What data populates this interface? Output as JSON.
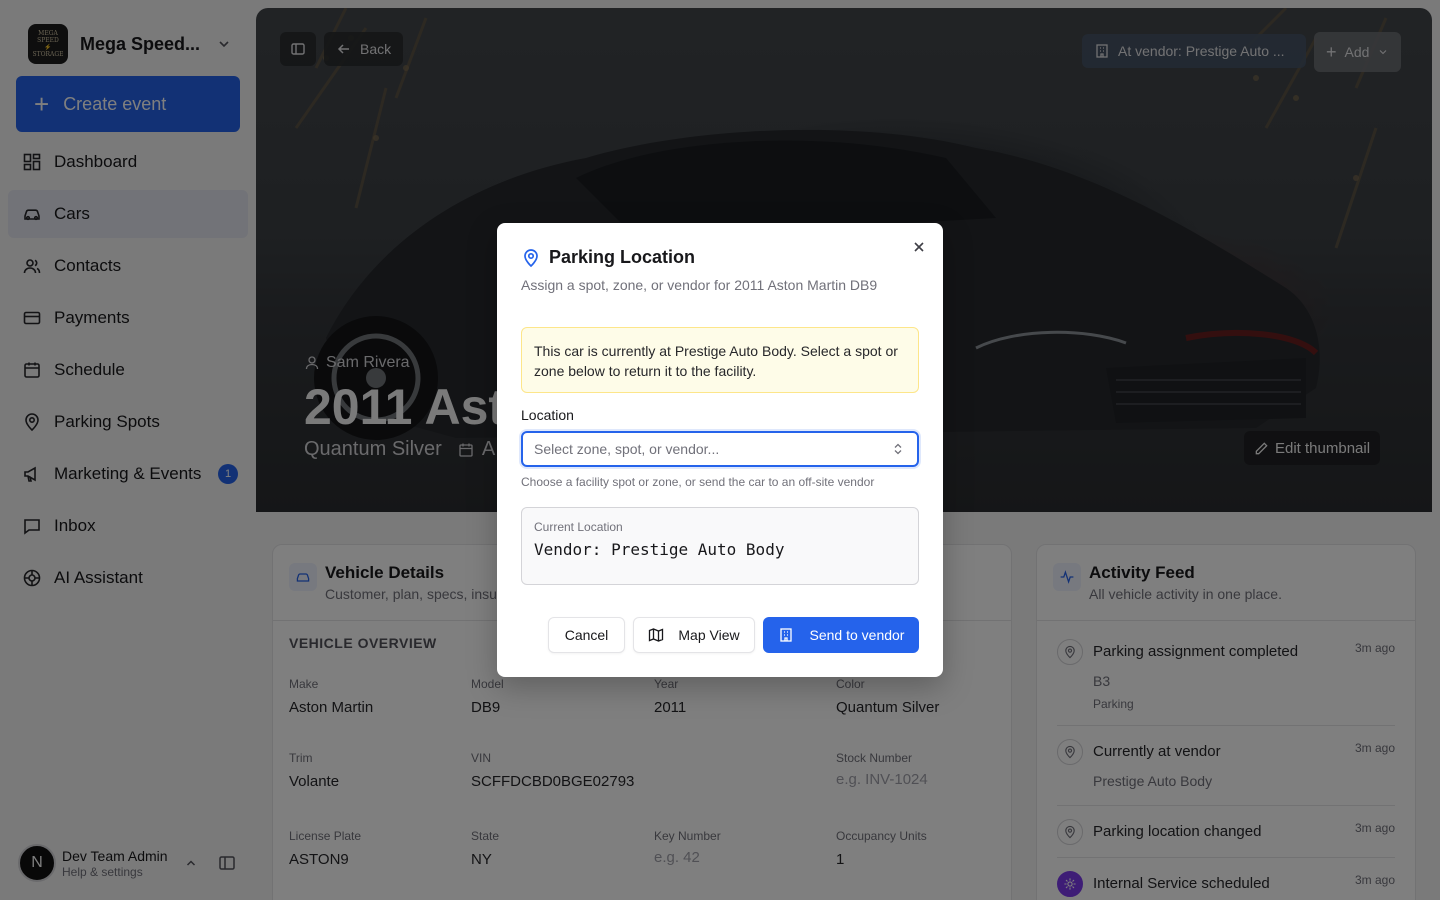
{
  "sidebar": {
    "brand_name": "Mega Speed...",
    "logo_text": [
      "MEGA SPEED",
      "STORAGE"
    ],
    "create_label": "Create event",
    "items": [
      {
        "label": "Dashboard",
        "icon": "dashboard-icon"
      },
      {
        "label": "Cars",
        "icon": "car-icon",
        "active": true
      },
      {
        "label": "Contacts",
        "icon": "contacts-icon"
      },
      {
        "label": "Payments",
        "icon": "credit-card-icon"
      },
      {
        "label": "Schedule",
        "icon": "calendar-icon"
      },
      {
        "label": "Parking Spots",
        "icon": "map-pin-icon"
      },
      {
        "label": "Marketing & Events",
        "icon": "megaphone-icon",
        "badge": "1"
      },
      {
        "label": "Inbox",
        "icon": "message-icon"
      },
      {
        "label": "AI Assistant",
        "icon": "brain-icon"
      }
    ],
    "user": {
      "initial": "N",
      "name": "Dev Team Admin",
      "sub": "Help & settings"
    }
  },
  "hero": {
    "back_label": "Back",
    "vendor_label": "At vendor: Prestige Auto ...",
    "add_label": "Add",
    "owner": "Sam Rivera",
    "title": "2011 Ast",
    "color": "Quantum Silver",
    "sub_extra": "A",
    "edit_thumbnail": "Edit thumbnail"
  },
  "vehicle_details": {
    "title": "Vehicle Details",
    "desc": "Customer, plan, specs, insu",
    "section": "VEHICLE OVERVIEW",
    "fields": [
      {
        "label": "Make",
        "value": "Aston Martin"
      },
      {
        "label": "Model",
        "value": "DB9"
      },
      {
        "label": "Year",
        "value": "2011"
      },
      {
        "label": "Color",
        "value": "Quantum Silver"
      },
      {
        "label": "Trim",
        "value": "Volante"
      },
      {
        "label": "VIN",
        "value": "SCFFDCBD0BGE02793"
      },
      {
        "label": "Stock Number",
        "value": "e.g. INV-1024",
        "placeholder": true
      },
      {
        "label": "License Plate",
        "value": "ASTON9"
      },
      {
        "label": "State",
        "value": "NY"
      },
      {
        "label": "Key Number",
        "value": "e.g. 42",
        "placeholder": true
      },
      {
        "label": "Occupancy Units",
        "value": "1"
      }
    ]
  },
  "activity": {
    "title": "Activity Feed",
    "desc": "All vehicle activity in one place.",
    "items": [
      {
        "title": "Parking assignment completed",
        "time": "3m ago",
        "sub1": "B3",
        "sub2": "Parking"
      },
      {
        "title": "Currently at vendor",
        "time": "3m ago",
        "sub1": "Prestige Auto Body"
      },
      {
        "title": "Parking location changed",
        "time": "3m ago"
      },
      {
        "title": "Internal Service scheduled",
        "time": "3m ago"
      }
    ]
  },
  "modal": {
    "title": "Parking Location",
    "description": "Assign a spot, zone, or vendor for 2011 Aston Martin DB9",
    "alert": "This car is currently at Prestige Auto Body. Select a spot or zone below to return it to the facility.",
    "location_label": "Location",
    "select_placeholder": "Select zone, spot, or vendor...",
    "help": "Choose a facility spot or zone, or send the car to an off-site vendor",
    "current_label": "Current Location",
    "current_value": "Vendor: Prestige Auto Body",
    "cancel": "Cancel",
    "map_view": "Map View",
    "send": "Send to vendor"
  },
  "colors": {
    "accent": "#2563eb",
    "alert_bg": "#fefce8",
    "alert_border": "#fde68a",
    "active_nav": "#e4e7f0"
  }
}
